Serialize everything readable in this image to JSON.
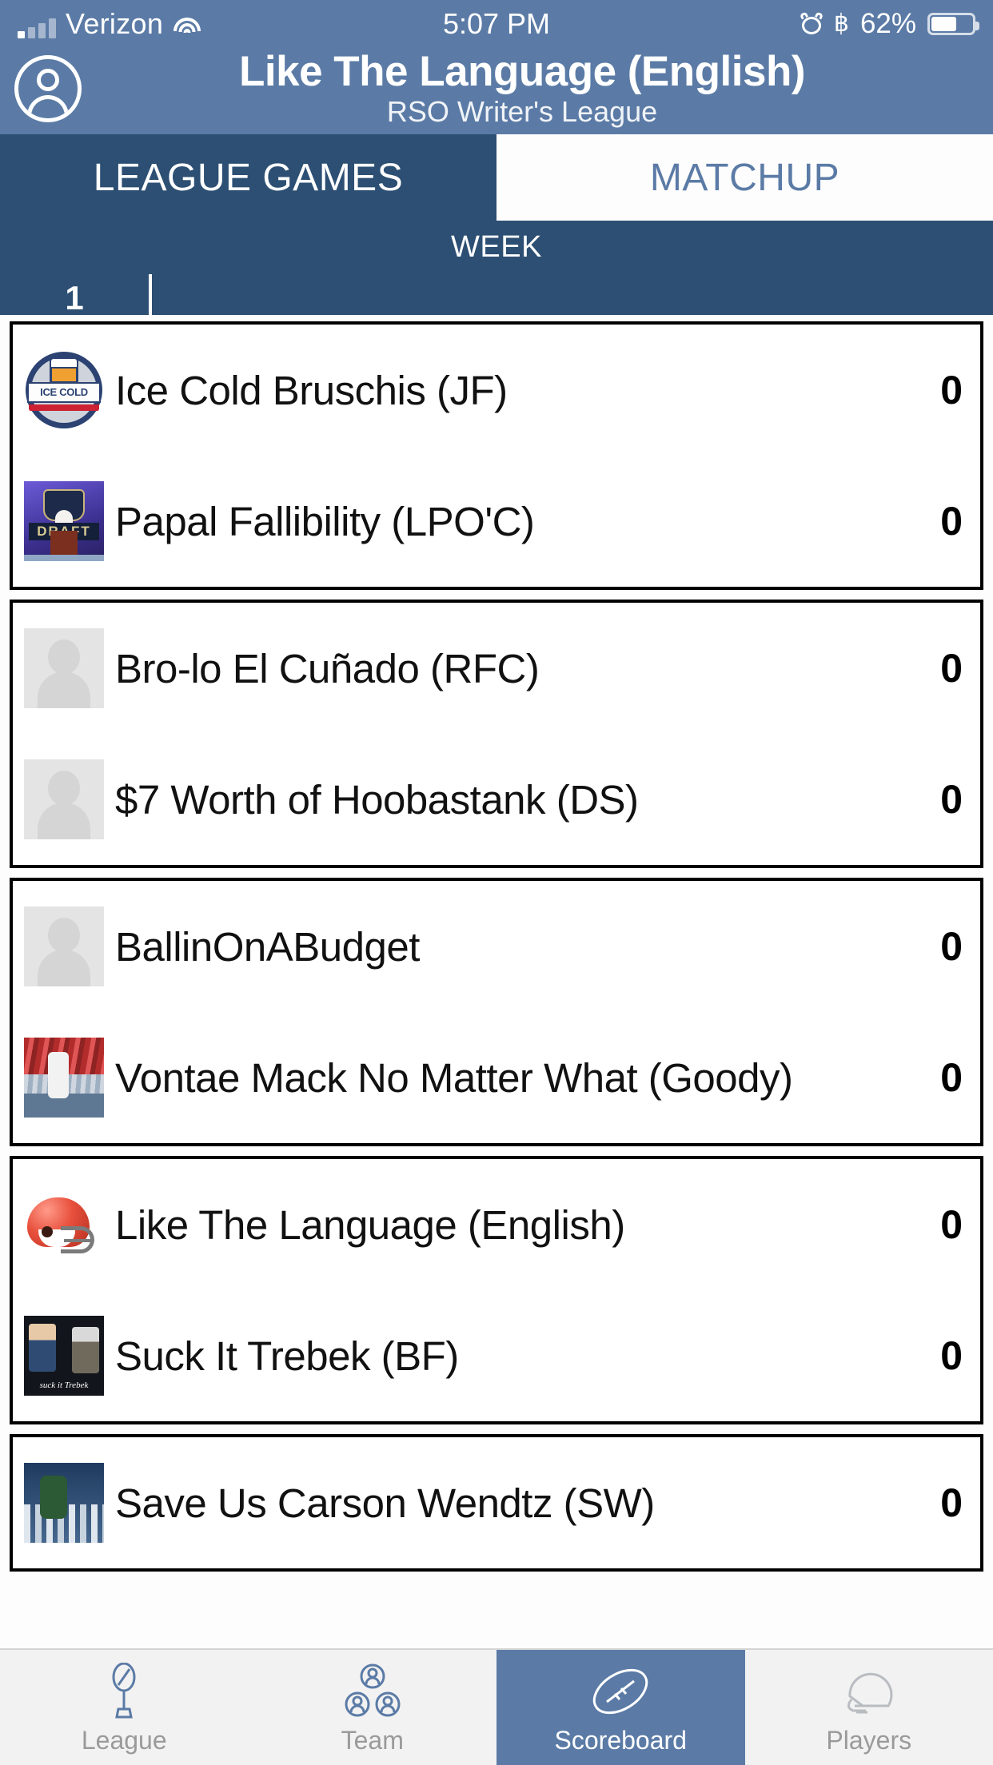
{
  "status_bar": {
    "carrier": "Verizon",
    "time": "5:07 PM",
    "battery_percent": "62%",
    "icons": [
      "signal-bars-icon",
      "wifi-icon",
      "alarm-clock-icon",
      "bluetooth-icon",
      "battery-icon"
    ],
    "bluetooth_glyph": "฿"
  },
  "header": {
    "title": "Like The Language (English)",
    "subtitle": "RSO Writer's League",
    "avatar_icon": "user-avatar-icon"
  },
  "segments": [
    {
      "label": "LEAGUE GAMES",
      "active": true
    },
    {
      "label": "MATCHUP",
      "active": false
    }
  ],
  "week_selector": {
    "label": "WEEK",
    "selected": "1"
  },
  "matchups": [
    {
      "teams": [
        {
          "name": "Ice Cold Bruschis (JF)",
          "score": "0",
          "logo": "ice-cold-bruschis-crest-logo",
          "logo_text": "ICE COLD"
        },
        {
          "name": "Papal Fallibility (LPO'C)",
          "score": "0",
          "logo": "nfl-draft-podium-logo",
          "logo_text": "DRAFT"
        }
      ]
    },
    {
      "teams": [
        {
          "name": "Bro-lo El Cuñado (RFC)",
          "score": "0",
          "logo": "placeholder-avatar-logo",
          "logo_text": ""
        },
        {
          "name": "$7 Worth of Hoobastank (DS)",
          "score": "0",
          "logo": "placeholder-avatar-logo",
          "logo_text": ""
        }
      ]
    },
    {
      "teams": [
        {
          "name": "BallinOnABudget",
          "score": "0",
          "logo": "placeholder-avatar-logo",
          "logo_text": ""
        },
        {
          "name": "Vontae Mack No Matter What (Goody)",
          "score": "0",
          "logo": "crowd-photo-logo",
          "logo_text": ""
        }
      ]
    },
    {
      "teams": [
        {
          "name": "Like The Language (English)",
          "score": "0",
          "logo": "red-football-helmet-logo",
          "logo_text": ""
        },
        {
          "name": "Suck It Trebek (BF)",
          "score": "0",
          "logo": "suck-it-trebek-logo",
          "logo_text": "suck it Trebek"
        }
      ]
    },
    {
      "teams": [
        {
          "name": "Save Us Carson Wendtz (SW)",
          "score": "0",
          "logo": "skyline-photo-logo",
          "logo_text": ""
        }
      ]
    }
  ],
  "tab_bar": [
    {
      "label": "League",
      "icon": "trophy-icon",
      "active": false
    },
    {
      "label": "Team",
      "icon": "people-icon",
      "active": false
    },
    {
      "label": "Scoreboard",
      "icon": "football-icon",
      "active": true
    },
    {
      "label": "Players",
      "icon": "helmet-icon",
      "active": false
    }
  ],
  "colors": {
    "header_blue": "#5b7ba6",
    "dark_blue": "#2c4f73",
    "tabbar_bg": "#f2f2f2",
    "inactive_label": "#9a9a9a"
  }
}
